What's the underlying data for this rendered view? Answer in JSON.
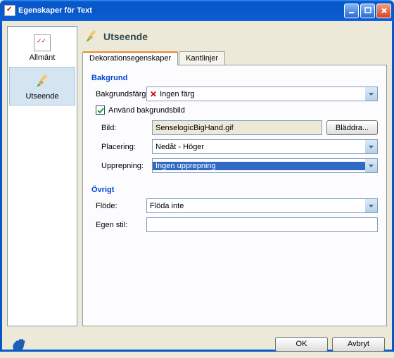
{
  "window": {
    "title": "Egenskaper för Text"
  },
  "sidebar": {
    "items": [
      {
        "label": "Allmänt"
      },
      {
        "label": "Utseende"
      }
    ]
  },
  "main": {
    "title": "Utseende"
  },
  "tabs": [
    {
      "label": "Dekorationsegenskaper"
    },
    {
      "label": "Kantlinjer"
    }
  ],
  "groups": {
    "background": {
      "title": "Bakgrund",
      "bg_color_label": "Bakgrundsfärg:",
      "bg_color_value": "Ingen färg",
      "use_image_label": "Använd bakgrundsbild",
      "image_label": "Bild:",
      "image_value": "SenselogicBigHand.gif",
      "browse_label": "Bläddra...",
      "position_label": "Placering:",
      "position_value": "Nedåt - Höger",
      "repeat_label": "Upprepning:",
      "repeat_value": "Ingen upprepning"
    },
    "other": {
      "title": "Övrigt",
      "float_label": "Flöde:",
      "float_value": "Flöda inte",
      "style_label": "Egen stil:",
      "style_value": ""
    }
  },
  "footer": {
    "ok": "OK",
    "cancel": "Avbryt"
  }
}
